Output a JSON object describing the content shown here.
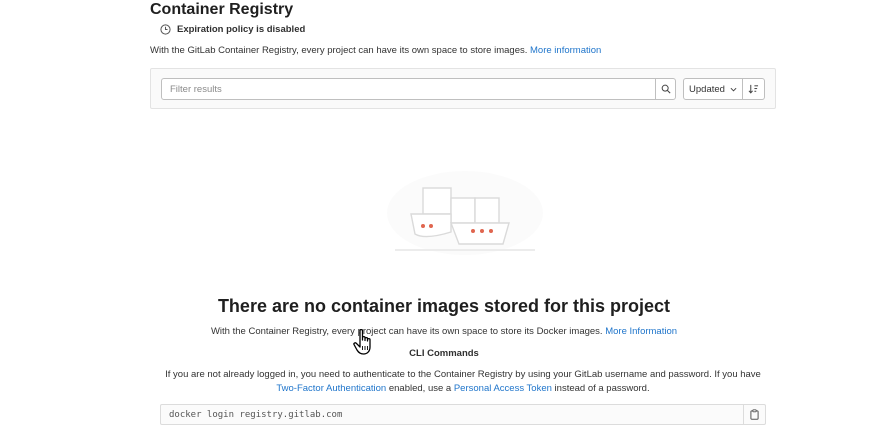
{
  "header": {
    "title": "Container Registry",
    "policy_text": "Expiration policy is disabled",
    "intro_text": "With the GitLab Container Registry, every project can have its own space to store images.",
    "intro_link": "More information"
  },
  "filter": {
    "placeholder": "Filter results",
    "value": "",
    "sort_label": "Updated"
  },
  "empty_state": {
    "title": "There are no container images stored for this project",
    "desc_text": "With the Container Registry, every project can have its own space to store its Docker images.",
    "desc_link": "More Information",
    "cli_title": "CLI Commands",
    "cli_part1": "If you are not already logged in, you need to authenticate to the Container Registry by using your GitLab username and password. If you have",
    "cli_link1": "Two-Factor Authentication",
    "cli_part2": "enabled, use a",
    "cli_link2": "Personal Access Token",
    "cli_part3": "instead of a password.",
    "command": "docker login registry.gitlab.com"
  },
  "colors": {
    "link": "#1f75cb",
    "accent_dots": "#e0664f"
  },
  "icons": [
    "clock-icon",
    "search-icon",
    "chevron-down-icon",
    "sort-direction-icon",
    "copy-icon",
    "hand-cursor-icon"
  ]
}
